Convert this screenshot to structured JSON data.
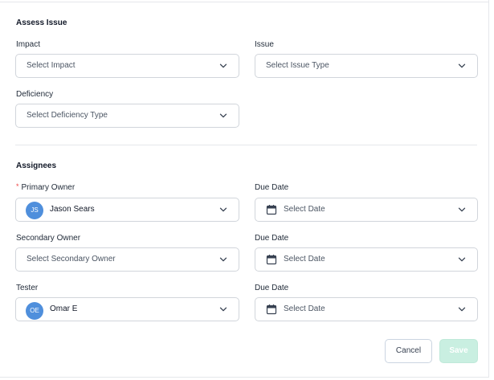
{
  "assess": {
    "title": "Assess Issue",
    "impact": {
      "label": "Impact",
      "placeholder": "Select Impact"
    },
    "issue": {
      "label": "Issue",
      "placeholder": "Select Issue Type"
    },
    "deficiency": {
      "label": "Deficiency",
      "placeholder": "Select Deficiency Type"
    }
  },
  "assignees": {
    "title": "Assignees",
    "required_mark": "*",
    "primary_owner": {
      "label": "Primary Owner",
      "initials": "JS",
      "value": "Jason Sears"
    },
    "primary_due": {
      "label": "Due Date",
      "placeholder": "Select Date"
    },
    "secondary_owner": {
      "label": "Secondary Owner",
      "placeholder": "Select Secondary Owner"
    },
    "secondary_due": {
      "label": "Due Date",
      "placeholder": "Select Date"
    },
    "tester": {
      "label": "Tester",
      "initials": "OE",
      "value": "Omar E"
    },
    "tester_due": {
      "label": "Due Date",
      "placeholder": "Select Date"
    }
  },
  "actions": {
    "cancel": "Cancel",
    "save": "Save"
  },
  "colors": {
    "avatar": "#4f8fdc",
    "required": "#ef4444",
    "save_disabled": "#c9efe1"
  },
  "icons": {
    "dropdown": "chevron-down-icon",
    "date": "calendar-icon"
  }
}
